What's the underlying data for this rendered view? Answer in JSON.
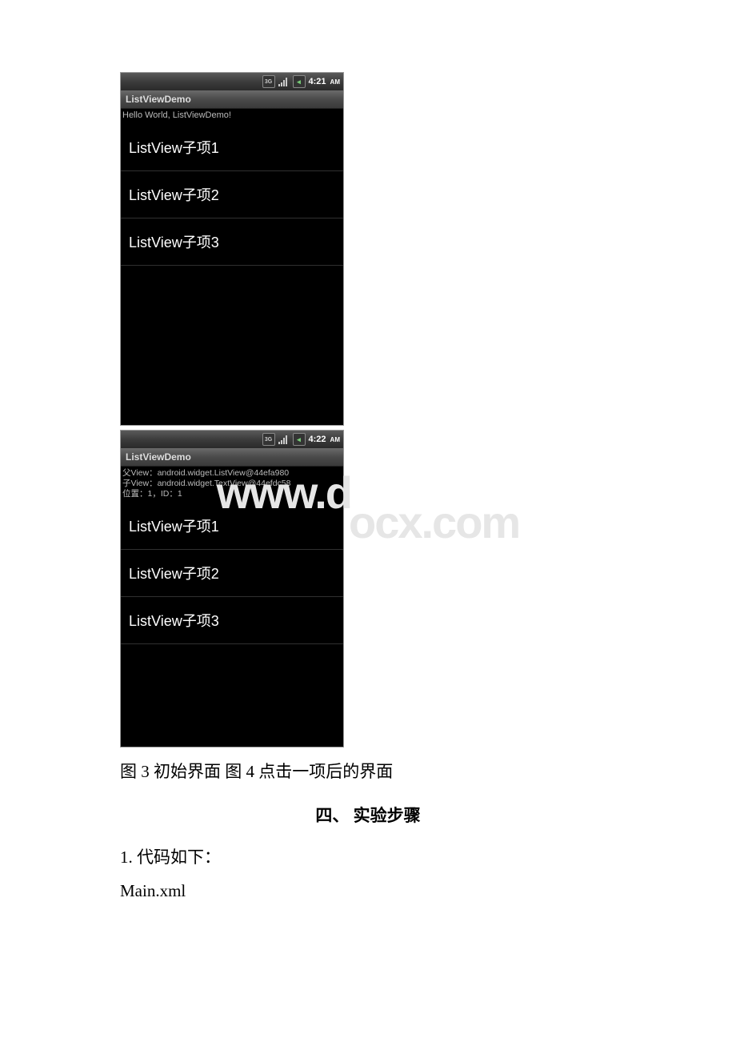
{
  "phone1": {
    "time": "4:21",
    "ampm": "AM",
    "title": "ListViewDemo",
    "hello": "Hello World, ListViewDemo!",
    "items": [
      "ListView子项1",
      "ListView子项2",
      "ListView子项3"
    ]
  },
  "phone2": {
    "time": "4:22",
    "ampm": "AM",
    "title": "ListViewDemo",
    "info_line1": "父View：android.widget.ListView@44efa980",
    "info_line2": "子View：android.widget.TextView@44efdc58",
    "info_line3": "位置：1，ID：1",
    "items": [
      "ListView子项1",
      "ListView子项2",
      "ListView子项3"
    ]
  },
  "watermark_left": "www.d",
  "watermark_right": "ocx.com",
  "caption": "图 3 初始界面 图 4 点击一项后的界面",
  "section_title": "四、 实验步骤",
  "line1": "1. 代码如下：",
  "line2": "Main.xml"
}
